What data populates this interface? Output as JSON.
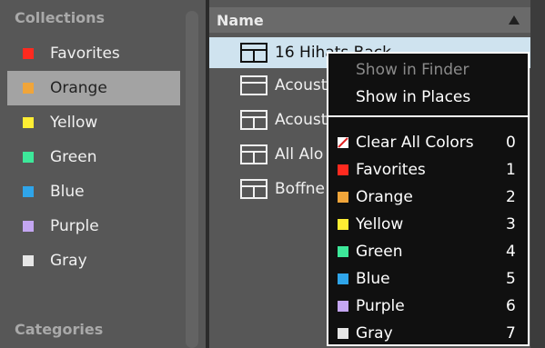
{
  "collections": {
    "title": "Collections",
    "items": [
      {
        "label": "Favorites",
        "color": "#ff2a1f",
        "selected": false
      },
      {
        "label": "Orange",
        "color": "#f0a53a",
        "selected": true
      },
      {
        "label": "Yellow",
        "color": "#ffee33",
        "selected": false
      },
      {
        "label": "Green",
        "color": "#3de89a",
        "selected": false
      },
      {
        "label": "Blue",
        "color": "#2fa5ea",
        "selected": false
      },
      {
        "label": "Purple",
        "color": "#c4a6f2",
        "selected": false
      },
      {
        "label": "Gray",
        "color": "#e6e6e6",
        "selected": false
      }
    ],
    "categories_title": "Categories"
  },
  "browser": {
    "column_header": "Name",
    "files": [
      {
        "name": "16 Hihats Back",
        "selected": true
      },
      {
        "name": "Acoust",
        "selected": false
      },
      {
        "name": "Acoust",
        "selected": false
      },
      {
        "name": "All Alo",
        "selected": false
      },
      {
        "name": "Boffne",
        "selected": false
      }
    ]
  },
  "context_menu": {
    "items": [
      {
        "label": "Show in Finder",
        "disabled": true
      },
      {
        "label": "Show in Places",
        "disabled": false
      }
    ],
    "color_items": [
      {
        "label": "Clear All Colors",
        "shortcut": "0",
        "color": "#ffffff"
      },
      {
        "label": "Favorites",
        "shortcut": "1",
        "color": "#ff2a1f"
      },
      {
        "label": "Orange",
        "shortcut": "2",
        "color": "#f0a53a"
      },
      {
        "label": "Yellow",
        "shortcut": "3",
        "color": "#ffee33"
      },
      {
        "label": "Green",
        "shortcut": "4",
        "color": "#3de89a"
      },
      {
        "label": "Blue",
        "shortcut": "5",
        "color": "#2fa5ea"
      },
      {
        "label": "Purple",
        "shortcut": "6",
        "color": "#c4a6f2"
      },
      {
        "label": "Gray",
        "shortcut": "7",
        "color": "#e6e6e6"
      }
    ]
  }
}
